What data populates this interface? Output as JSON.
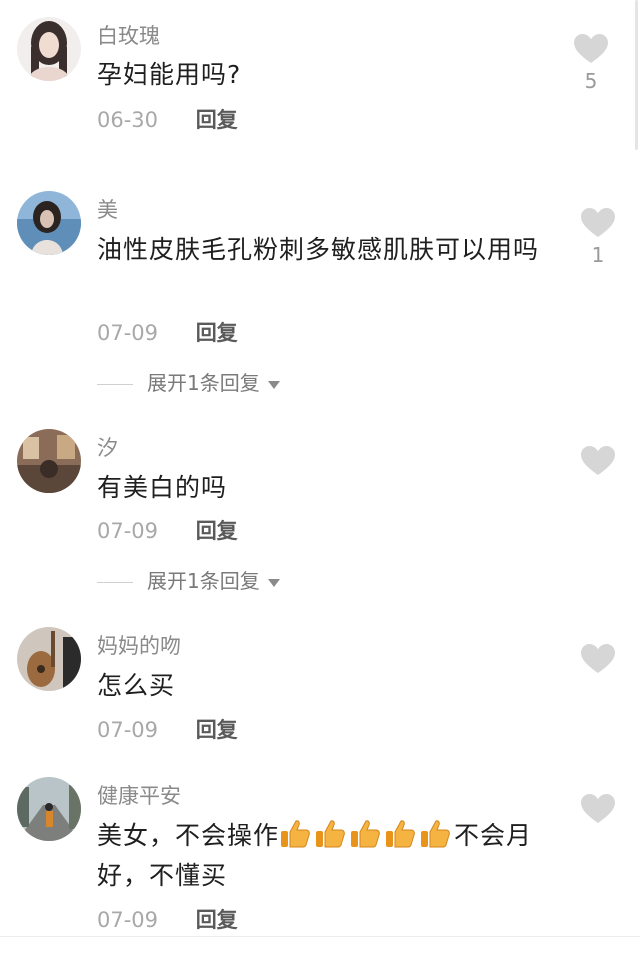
{
  "comments": [
    {
      "username": "白玫瑰",
      "text": "孕妇能用吗?",
      "date": "06-30",
      "reply_label": "回复",
      "like_count": "5",
      "avatar_icon": "avatar-woman-long-hair"
    },
    {
      "username": "美",
      "text": "油性皮肤毛孔粉刺多敏感肌肤可以用吗",
      "date": "07-09",
      "reply_label": "回复",
      "like_count": "1",
      "expand_label": "展开1条回复",
      "avatar_icon": "avatar-girl-sea"
    },
    {
      "username": "汐",
      "text": "有美白的吗",
      "date": "07-09",
      "reply_label": "回复",
      "like_count": "",
      "expand_label": "展开1条回复",
      "avatar_icon": "avatar-indoor-scene"
    },
    {
      "username": "妈妈的吻",
      "text": "怎么买",
      "date": "07-09",
      "reply_label": "回复",
      "like_count": "",
      "avatar_icon": "avatar-guitar"
    },
    {
      "username": "健康平安",
      "text_before": "美女，不会操作",
      "text_after": "不会月好，不懂买",
      "thumbs_count": 5,
      "date": "07-09",
      "reply_label": "回复",
      "like_count": "",
      "avatar_icon": "avatar-street-person"
    }
  ],
  "colors": {
    "heart": "#d6d6d6",
    "username": "#8a8a8a",
    "date": "#a8a8a8",
    "thumbs_emoji": "#f5a623"
  },
  "icons": {
    "like": "heart-icon",
    "expand": "triangle-down-icon",
    "emoji": "thumbs-up-emoji"
  }
}
